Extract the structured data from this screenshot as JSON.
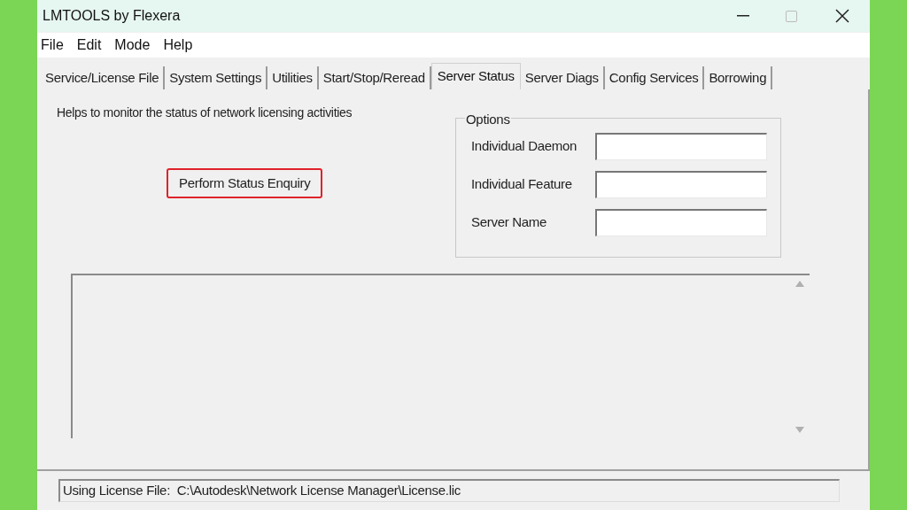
{
  "window": {
    "title": "LMTOOLS by Flexera"
  },
  "menu": [
    "File",
    "Edit",
    "Mode",
    "Help"
  ],
  "tabs": [
    {
      "label": "Service/License File",
      "selected": false
    },
    {
      "label": "System Settings",
      "selected": false
    },
    {
      "label": "Utilities",
      "selected": false
    },
    {
      "label": "Start/Stop/Reread",
      "selected": false
    },
    {
      "label": "Server Status",
      "selected": true
    },
    {
      "label": "Server Diags",
      "selected": false
    },
    {
      "label": "Config Services",
      "selected": false
    },
    {
      "label": "Borrowing",
      "selected": false
    }
  ],
  "description": "Helps to monitor the status of network licensing activities",
  "enquiry_button": {
    "label": "Perform Status Enquiry",
    "highlighted": true
  },
  "options": {
    "title": "Options",
    "fields": [
      {
        "label": "Individual Daemon"
      },
      {
        "label": "Individual Feature"
      },
      {
        "label": "Server Name"
      }
    ]
  },
  "status_bar": "Using License File:  C:\\Autodesk\\Network License Manager\\License.lic"
}
